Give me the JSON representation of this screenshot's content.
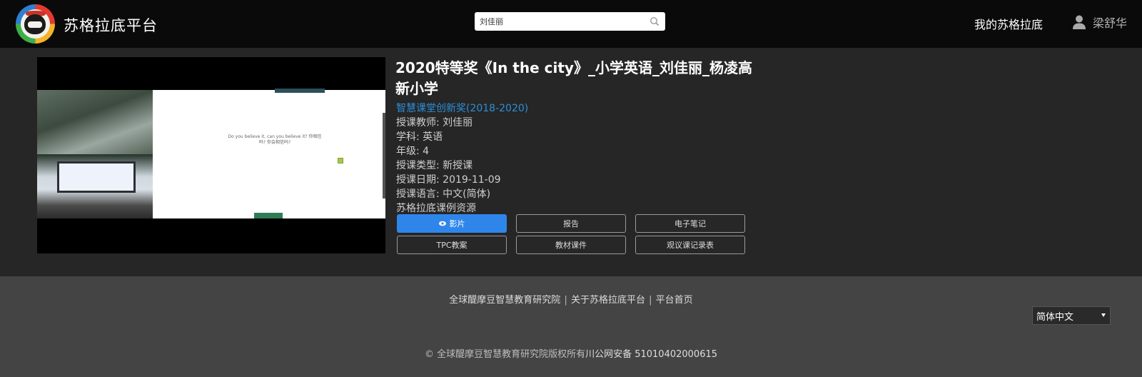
{
  "header": {
    "brand": "苏格拉底平台",
    "search_value": "刘佳丽",
    "nav_mine": "我的苏格拉底",
    "user_name": "梁舒华"
  },
  "lesson": {
    "title": "2020特等奖《In the city》_小学英语_刘佳丽_杨凌高新小学",
    "award": "智慧课堂创新奖(2018-2020)",
    "teacher": "授课教师: 刘佳丽",
    "subject": "学科: 英语",
    "grade": "年级: 4",
    "type": "授课类型: 新授课",
    "date": "授课日期: 2019-11-09",
    "language": "授课语言: 中文(简体)",
    "resource": "苏格拉底课例资源"
  },
  "video": {
    "slide_text": "Do you believe it, can you believe it? 你相信吗? 你会相信吗?"
  },
  "buttons": {
    "video": "影片",
    "report": "报告",
    "notes": "电子笔记",
    "tpc": "TPC教案",
    "materials": "教材课件",
    "observation": "观议课记录表"
  },
  "footer": {
    "link1": "全球醍摩豆智慧教育研究院",
    "sep": "|",
    "link2": "关于苏格拉底平台",
    "link3": "平台首页",
    "language": "简体中文",
    "copyright": "© 全球醍摩豆智慧教育研究院版权所有",
    "icp": "川公网安备 51010402000615"
  },
  "colors": {
    "accent": "#2f86ea",
    "award_link": "#2a8fd8"
  }
}
